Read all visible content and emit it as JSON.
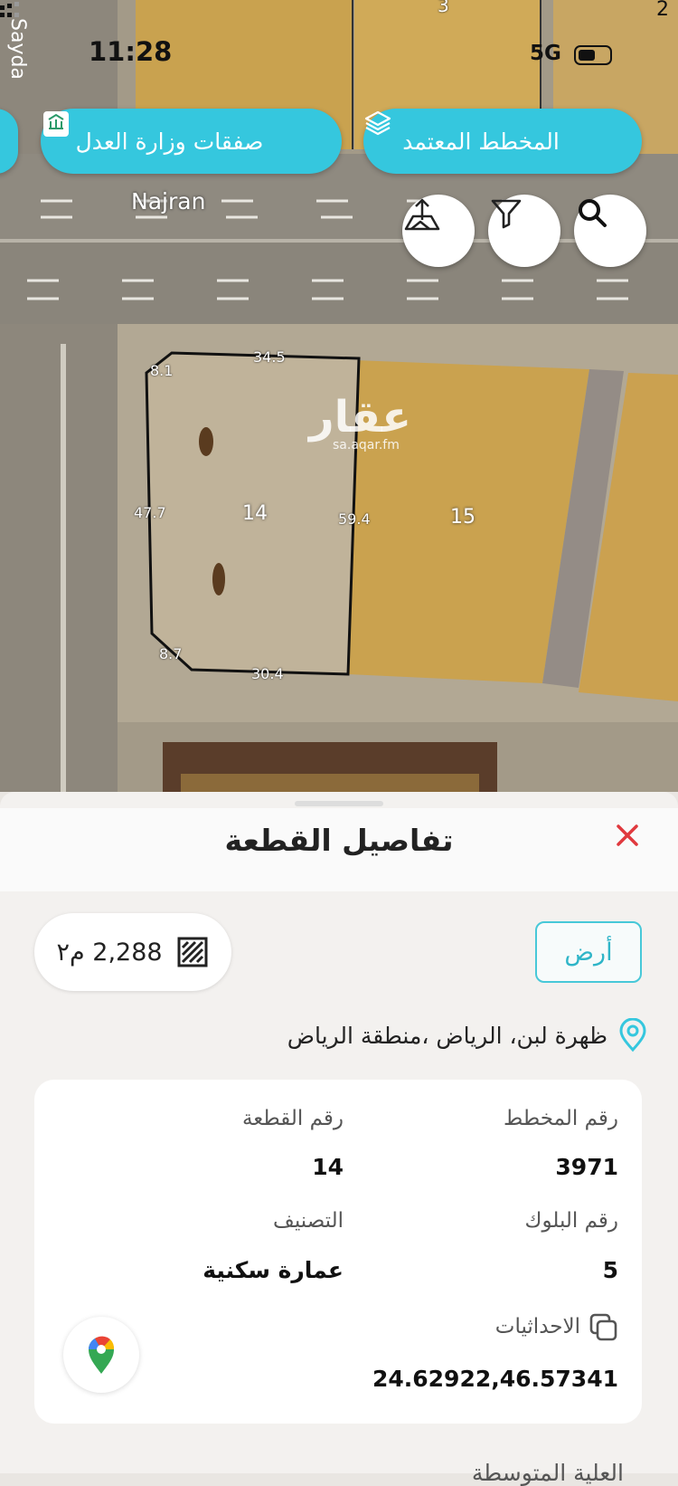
{
  "status_bar": {
    "time": "11:28",
    "network": "5G"
  },
  "map": {
    "street_top": "Sayda",
    "street_main": "Najran",
    "watermark": {
      "text": "عقار",
      "url": "sa.aqar.fm"
    },
    "plots": [
      {
        "number": "14"
      },
      {
        "number": "15"
      }
    ],
    "dimensions": [
      "34.5",
      "8.1",
      "47.7",
      "59.4",
      "8.7",
      "30.4"
    ],
    "corner_numbers": [
      "3",
      "2"
    ]
  },
  "toolbar": {
    "approved_plan": "المخطط المعتمد",
    "justice_deals": "صفقات وزارة العدل"
  },
  "sheet": {
    "title": "تفاصيل القطعة",
    "type_label": "أرض",
    "area_value": "2,288 م٢",
    "location": "ظهرة لبن، الرياض ،منطقة الرياض",
    "details": {
      "plan_number_label": "رقم المخطط",
      "plan_number": "3971",
      "plot_number_label": "رقم القطعة",
      "plot_number": "14",
      "block_number_label": "رقم البلوك",
      "block_number": "5",
      "classification_label": "التصنيف",
      "classification": "عمارة سكنية",
      "coordinates_label": "الاحداثيات",
      "coordinates": "24.62922,46.57341"
    },
    "footer_peek": "العلية المتوسطة"
  },
  "colors": {
    "accent": "#35c7de",
    "close": "#e0393e",
    "plot_fill": "#caa24f"
  }
}
